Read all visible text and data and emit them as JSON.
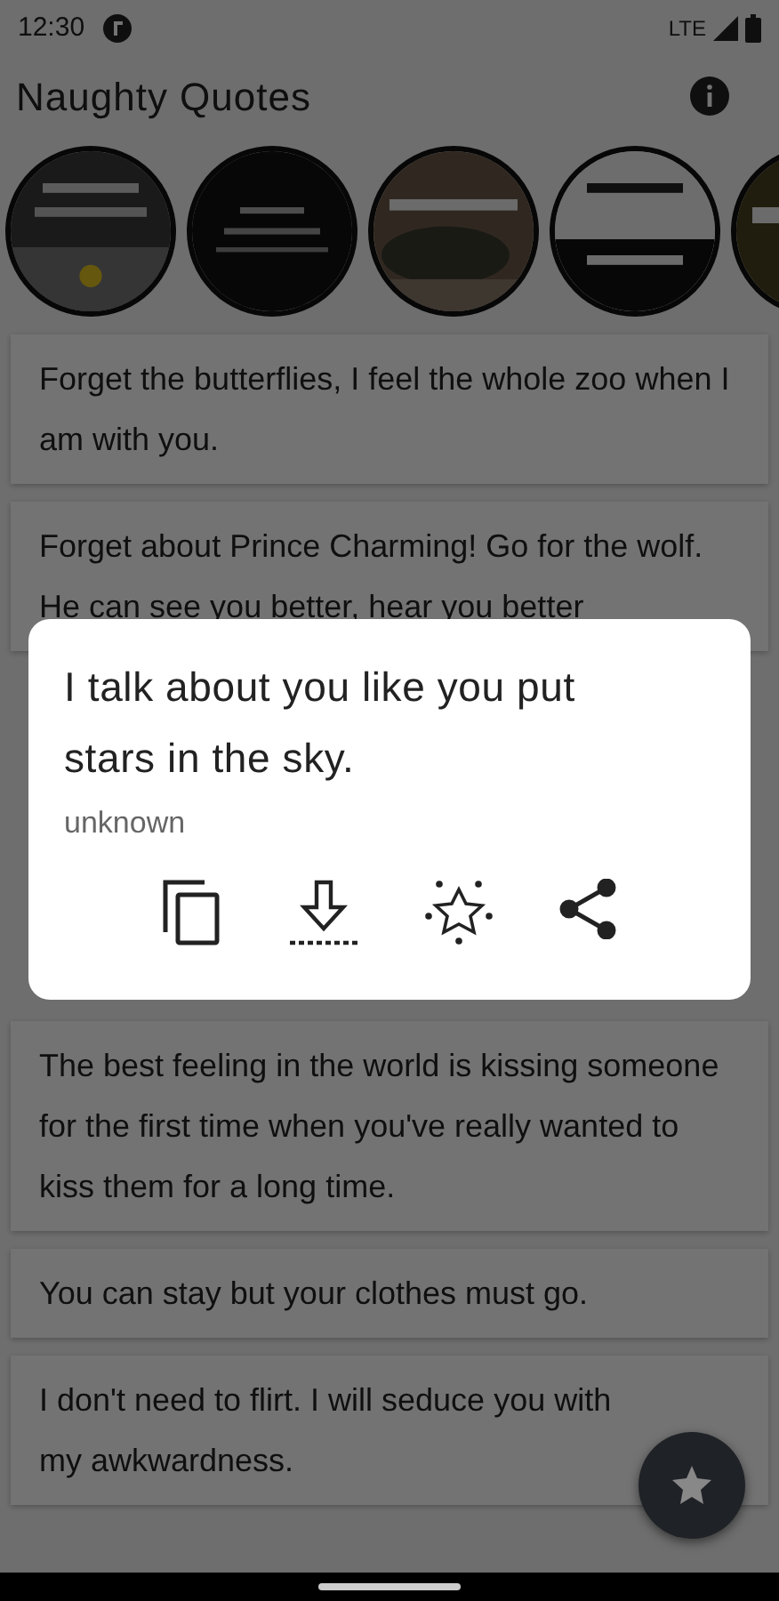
{
  "status_bar": {
    "time": "12:30",
    "network": "LTE"
  },
  "app_bar": {
    "title": "Naughty Quotes"
  },
  "quotes": [
    {
      "text": "Forget the butterflies, I feel the whole zoo when I am with you."
    },
    {
      "text": "Forget about Prince Charming! Go for the wolf. He can see you better, hear you better"
    },
    {
      "text": "The best feeling in the world is kissing someone for the first time when you've really wanted to kiss them for a long time."
    },
    {
      "text": "You can stay but your clothes must go."
    },
    {
      "text": "I don't need to flirt. I will seduce you with my awkwardness."
    }
  ],
  "dialog": {
    "quote": "I talk about you like you put stars in the sky.",
    "author": "unknown"
  }
}
